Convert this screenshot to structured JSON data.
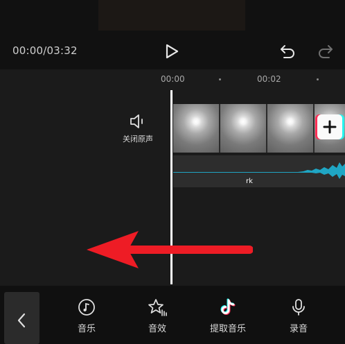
{
  "player": {
    "timecode": "00:00/03:32",
    "icons": [
      "play-icon",
      "undo-icon",
      "redo-icon"
    ]
  },
  "timeline": {
    "ruler": {
      "labels": [
        "00:00",
        "00:02"
      ]
    },
    "mute": {
      "label": "关闭原声",
      "icon": "speaker-muted-icon"
    },
    "audio_track": {
      "label_fragment": "rk"
    },
    "add_icon": "plus-icon",
    "annotation_arrow_color": "#ee1c25"
  },
  "toolbar": {
    "back_icon": "chevron-left-icon",
    "items": [
      {
        "label": "音乐",
        "icon": "music-disc-icon"
      },
      {
        "label": "音效",
        "icon": "sound-effect-star-icon"
      },
      {
        "label": "提取音乐",
        "icon": "tiktok-note-icon"
      },
      {
        "label": "录音",
        "icon": "microphone-icon"
      }
    ]
  },
  "colors": {
    "background": "#141414",
    "timeline": "#1b1b1b",
    "waveform": "#1fa6c4",
    "tiktok_red": "#ff2d55",
    "tiktok_cyan": "#25f4ee"
  }
}
